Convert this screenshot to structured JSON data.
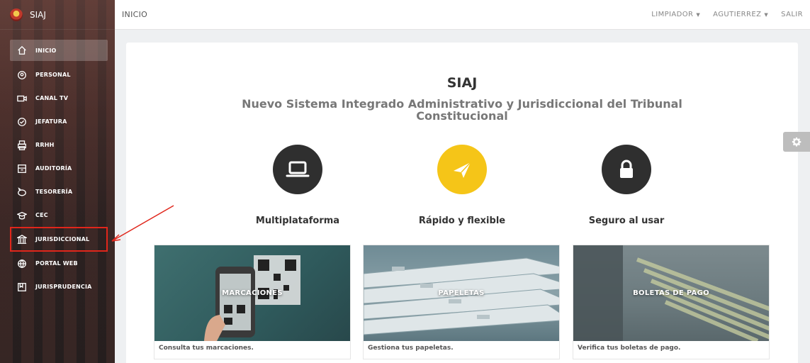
{
  "brand": {
    "name": "SIAJ"
  },
  "sidebar": {
    "items": [
      {
        "label": "INICIO",
        "icon": "home-icon"
      },
      {
        "label": "PERSONAL",
        "icon": "user-icon"
      },
      {
        "label": "CANAL TV",
        "icon": "video-icon"
      },
      {
        "label": "JEFATURA",
        "icon": "check-circle-icon"
      },
      {
        "label": "RRHH",
        "icon": "printer-icon"
      },
      {
        "label": "AUDITORÍA",
        "icon": "archive-icon"
      },
      {
        "label": "TESORERÍA",
        "icon": "piggy-bank-icon"
      },
      {
        "label": "CEC",
        "icon": "graduation-cap-icon"
      },
      {
        "label": "JURISDICCIONAL",
        "icon": "bank-icon"
      },
      {
        "label": "PORTAL WEB",
        "icon": "globe-icon"
      },
      {
        "label": "JURISPRUDENCIA",
        "icon": "book-icon"
      }
    ]
  },
  "topbar": {
    "title": "INICIO",
    "user_menu_1": "LIMPIADOR",
    "user_menu_2": "AGUTIERREZ",
    "logout": "SALIR",
    "caret": "▼"
  },
  "main": {
    "title": "SIAJ",
    "subtitle": "Nuevo Sistema Integrado Administrativo y Jurisdiccional del Tribunal Constitucional",
    "features": [
      {
        "label": "Multiplataforma",
        "icon": "laptop-icon",
        "color": "#2f2f2f"
      },
      {
        "label": "Rápido y flexible",
        "icon": "paper-plane-icon",
        "color": "#f5c518"
      },
      {
        "label": "Seguro al usar",
        "icon": "lock-icon",
        "color": "#2f2f2f"
      }
    ],
    "tiles": [
      {
        "label": "MARCACIONES",
        "caption": "Consulta tus marcaciones."
      },
      {
        "label": "PAPELETAS",
        "caption": "Gestiona tus papeletas."
      },
      {
        "label": "BOLETAS DE PAGO",
        "caption": "Verifica tus boletas de pago."
      }
    ]
  },
  "colors": {
    "highlight": "#e0261b",
    "accent_yellow": "#f5c518",
    "dark_circle": "#2f2f2f"
  }
}
